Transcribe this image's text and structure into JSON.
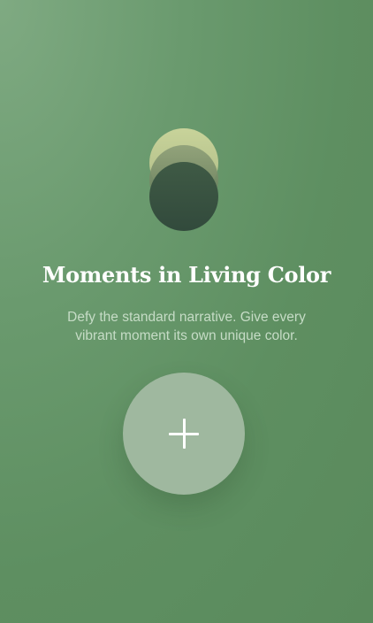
{
  "logo": {
    "icon": "layered-circles-logo-icon",
    "colors": [
      "#c8d39a",
      "#8e9f78",
      "#324a3c"
    ]
  },
  "onboarding": {
    "title": "Moments in Living Color",
    "subtitle_line1": "Defy the standard narrative. Give every",
    "subtitle_line2": "vibrant moment its own unique color."
  },
  "add_button": {
    "icon": "plus-icon"
  },
  "colors": {
    "background": "#6a9a6e",
    "title": "#ffffff",
    "subtitle": "#c6dcc6",
    "button": "#9fb89f"
  }
}
